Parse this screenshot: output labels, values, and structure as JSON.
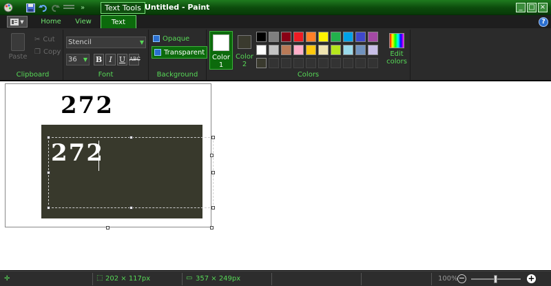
{
  "window": {
    "title": "Untitled - Paint",
    "context_tab_title": "Text Tools"
  },
  "tabs": [
    {
      "label": "Home"
    },
    {
      "label": "View"
    },
    {
      "label": "Text",
      "active": true
    }
  ],
  "clipboard": {
    "paste_label": "Paste",
    "cut_label": "Cut",
    "copy_label": "Copy",
    "group_label": "Clipboard"
  },
  "font": {
    "family": "Stencil",
    "size": "36",
    "group_label": "Font",
    "bold": "B",
    "italic": "I",
    "underline": "U",
    "strike": "ABC"
  },
  "background": {
    "opaque_label": "Opaque",
    "transparent_label": "Transparent",
    "selected": "transparent",
    "group_label": "Background"
  },
  "colors": {
    "color1_label_line1": "Color",
    "color1_label_line2": "1",
    "color2_label_line1": "Color",
    "color2_label_line2": "2",
    "color1": "#ffffff",
    "color2": "#3a3a2e",
    "edit_label_line1": "Edit",
    "edit_label_line2": "colors",
    "group_label": "Colors",
    "palette_row1": [
      "#000000",
      "#7f7f7f",
      "#880015",
      "#ed1c24",
      "#ff7f27",
      "#fff200",
      "#22b14c",
      "#00a2e8",
      "#3f48cc",
      "#a349a4"
    ],
    "palette_row2": [
      "#ffffff",
      "#c3c3c3",
      "#b97a57",
      "#ffaec9",
      "#ffc90e",
      "#efe4b0",
      "#b5e61d",
      "#99d9ea",
      "#7092be",
      "#c8bfe7"
    ],
    "palette_row3": [
      "#3a3a2e"
    ]
  },
  "canvas": {
    "text_top": "272",
    "text_box": "272",
    "rect_color": "#38392c"
  },
  "status": {
    "selection_size": "202 × 117px",
    "canvas_size": "357 × 249px",
    "zoom": "100%"
  },
  "icons": {
    "app": "paint-app-icon",
    "save": "save-icon",
    "undo": "undo-icon",
    "redo": "redo-icon",
    "minimize": "minimize-icon",
    "maximize": "maximize-icon",
    "close": "close-icon",
    "help": "help-icon"
  }
}
